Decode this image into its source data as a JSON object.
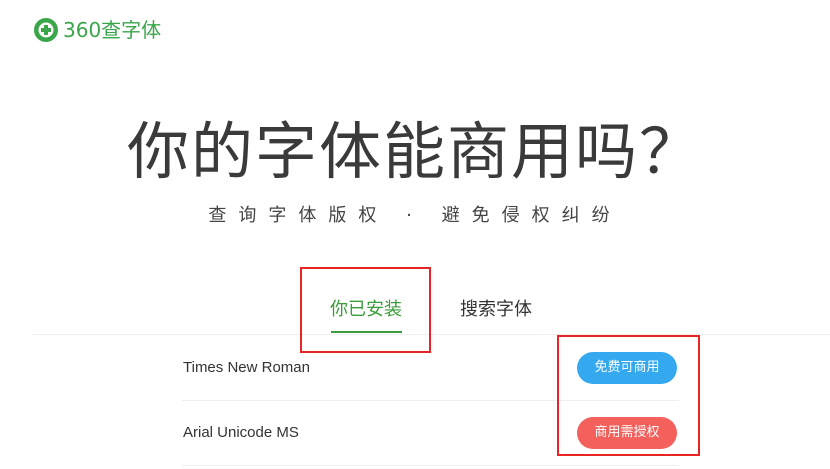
{
  "brand": {
    "logo_text": "360查字体",
    "accent": "#3aa64a"
  },
  "hero": {
    "title": "你的字体能商用吗？",
    "subtitle": "查询字体版权 · 避免侵权纠纷"
  },
  "tabs": [
    {
      "label": "你已安装",
      "active": true
    },
    {
      "label": "搜索字体",
      "active": false
    }
  ],
  "fonts": [
    {
      "name": "Times New Roman",
      "status": "免费可商用",
      "status_color": "#35a9ef"
    },
    {
      "name": "Arial Unicode MS",
      "status": "商用需授权",
      "status_color": "#f4605b"
    }
  ],
  "annotation_color": "#e82424"
}
